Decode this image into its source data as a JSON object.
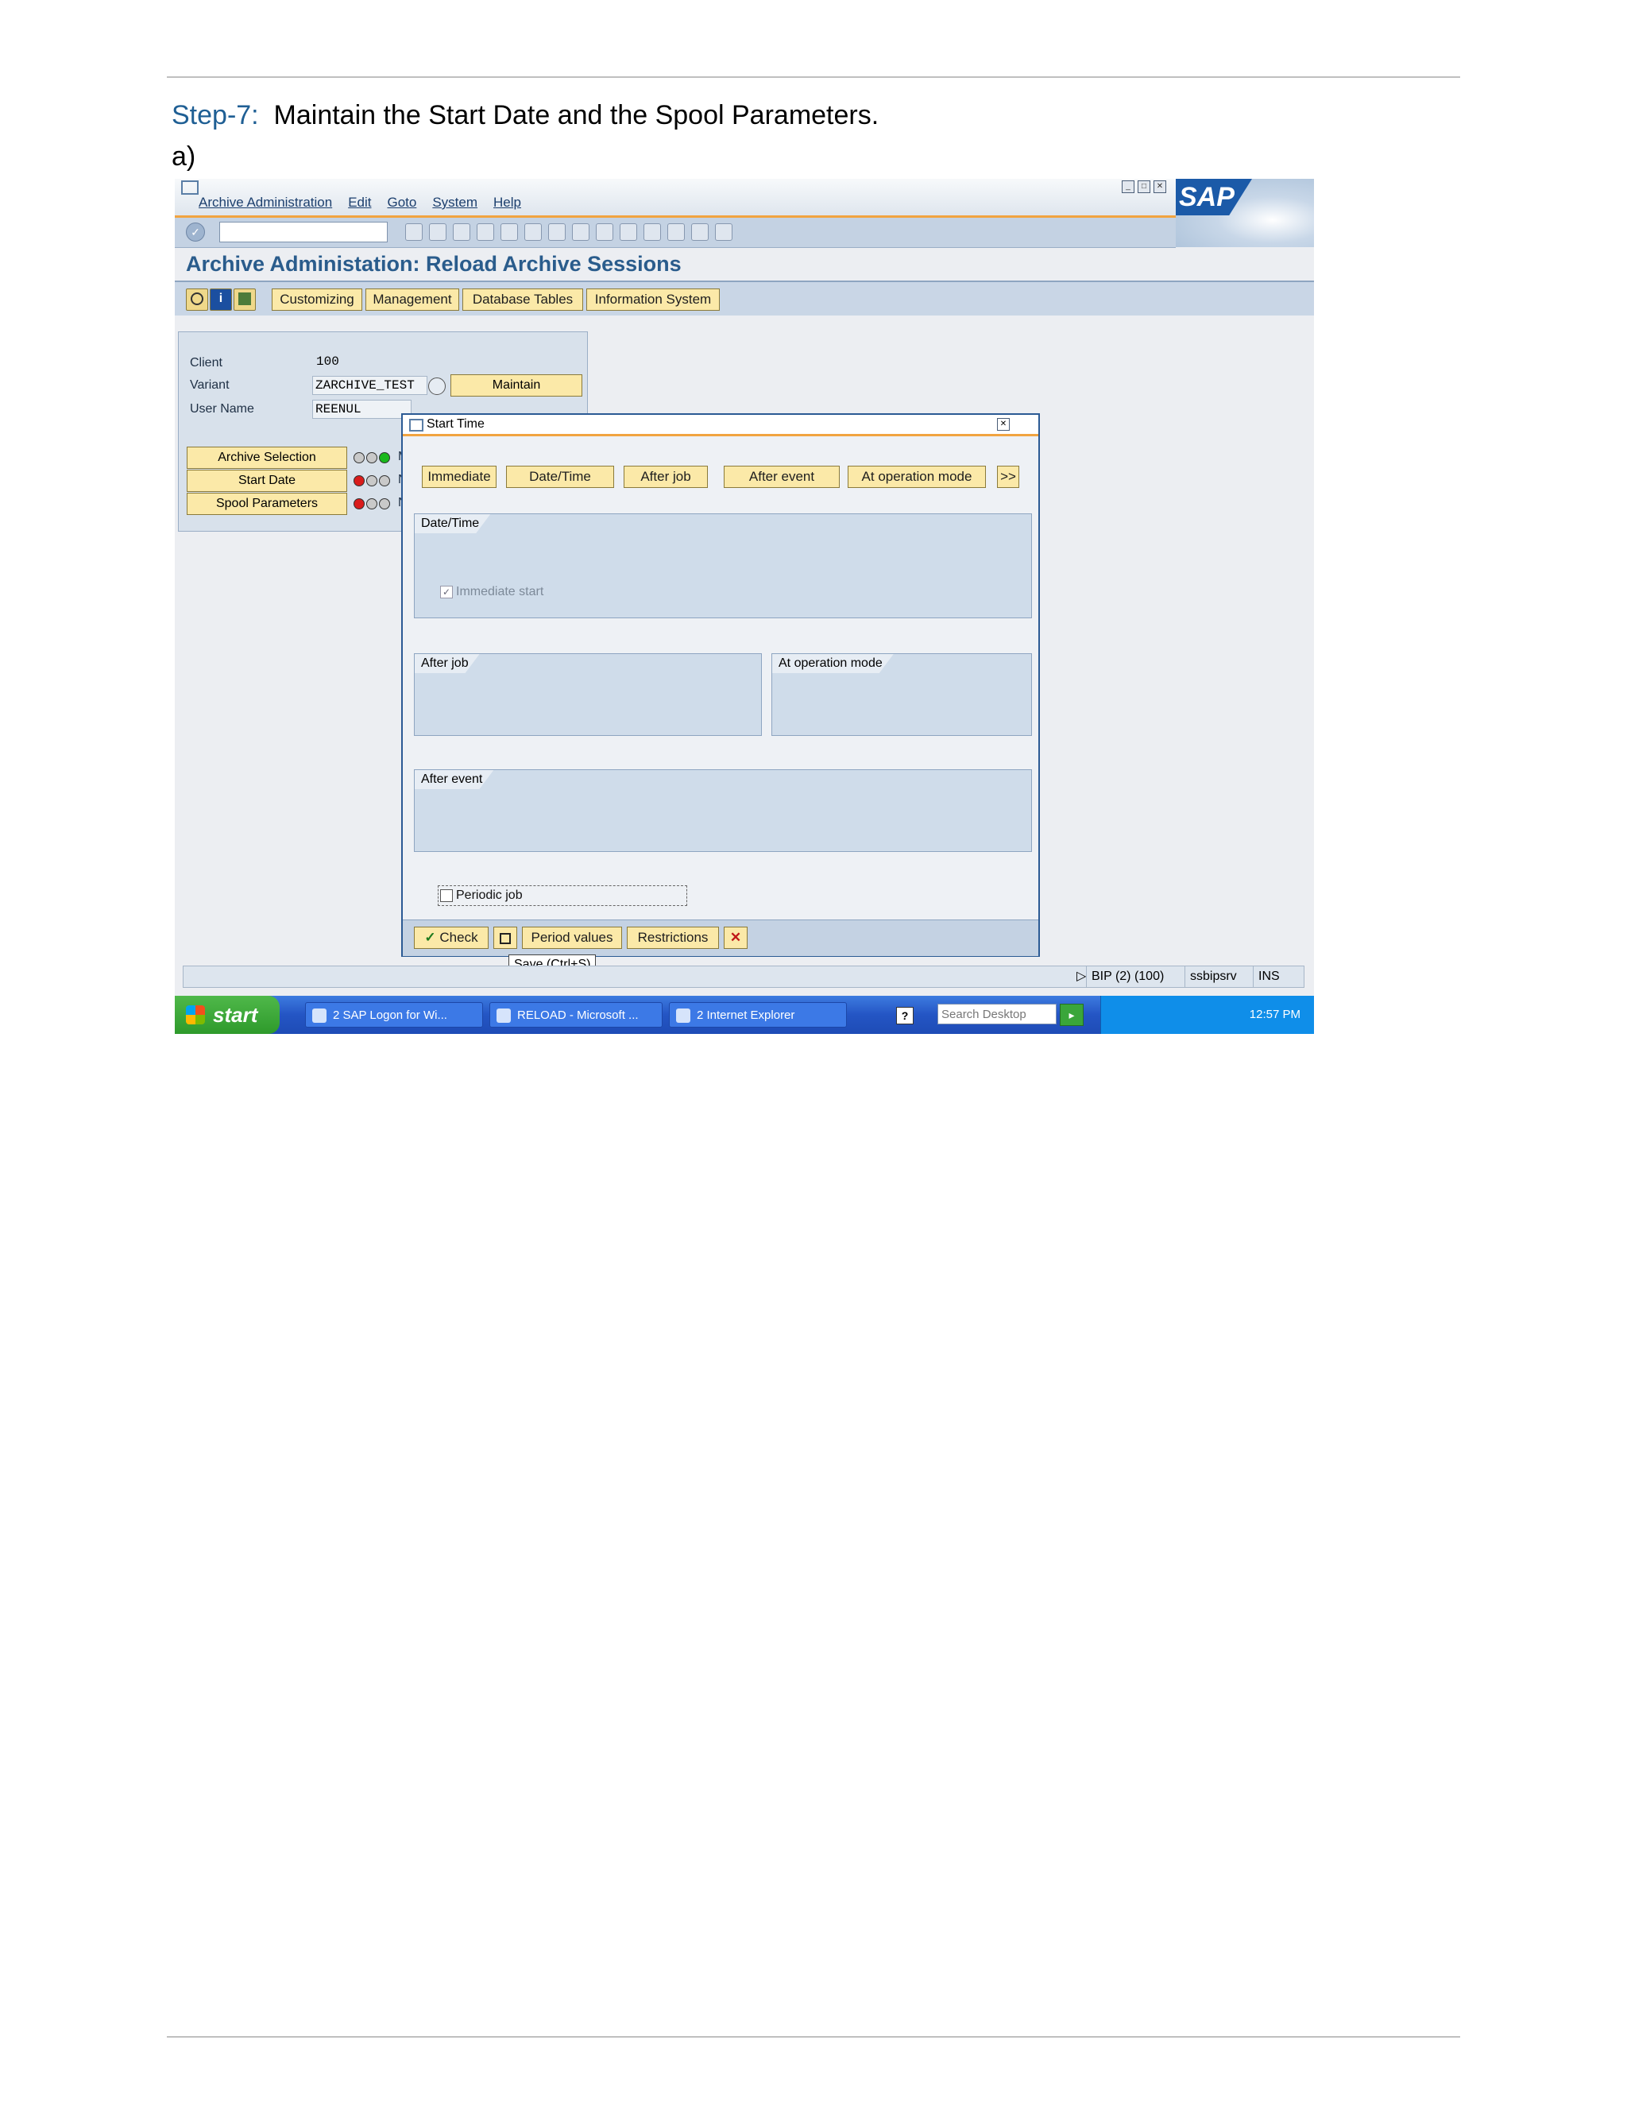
{
  "doc": {
    "step_label": "Step-7:",
    "step_text": "Maintain the Start Date and the Spool Parameters.",
    "sub_label": "a)"
  },
  "sap": {
    "menu": [
      "Archive Administration",
      "Edit",
      "Goto",
      "System",
      "Help"
    ],
    "logo": "SAP",
    "screen_title": "Archive Administation: Reload Archive Sessions",
    "app_buttons": [
      "Customizing",
      "Management",
      "Database Tables",
      "Information System"
    ],
    "fields": {
      "client_label": "Client",
      "client_value": "100",
      "variant_label": "Variant",
      "variant_value": "ZARCHIVE_TEST",
      "user_label": "User Name",
      "user_value": "REENUL",
      "maintain_button": "Maintain"
    },
    "steps": [
      "Archive Selection",
      "Start Date",
      "Spool Parameters"
    ],
    "step_trailing": [
      "M",
      "N",
      "N"
    ],
    "dialog": {
      "title": "Start Time",
      "buttons": [
        "Immediate",
        "Date/Time",
        "After job",
        "After event",
        "At operation mode",
        ">>"
      ],
      "group_datetime": "Date/Time",
      "immediate_start": "Immediate start",
      "group_after_job": "After job",
      "group_op_mode": "At operation mode",
      "group_after_event": "After event",
      "periodic_job": "Periodic job",
      "footer_buttons": [
        "Check",
        "Period values",
        "Restrictions"
      ]
    },
    "tooltip": "Save   (Ctrl+S)",
    "status": {
      "system": "BIP (2) (100)",
      "server": "ssbipsrv",
      "mode": "INS"
    },
    "taskbar": {
      "start": "start",
      "tasks": [
        "2 SAP Logon for Wi...",
        "RELOAD - Microsoft ...",
        "2 Internet Explorer"
      ],
      "search_placeholder": "Search Desktop",
      "clock": "12:57 PM"
    }
  }
}
